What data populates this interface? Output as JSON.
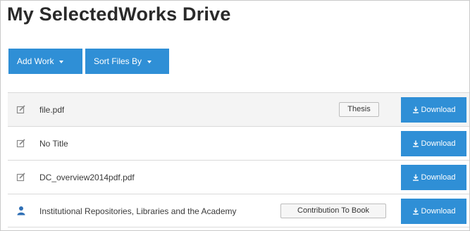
{
  "page": {
    "title": "My SelectedWorks Drive"
  },
  "toolbar": {
    "add_work_label": "Add Work",
    "sort_files_label": "Sort Files By"
  },
  "files": [
    {
      "name": "file.pdf",
      "icon": "edit-icon",
      "type": "Thesis",
      "download_label": "Download"
    },
    {
      "name": "No Title",
      "icon": "edit-icon",
      "type": "",
      "download_label": "Download"
    },
    {
      "name": "DC_overview2014pdf.pdf",
      "icon": "edit-icon",
      "type": "",
      "download_label": "Download"
    },
    {
      "name": "Institutional Repositories, Libraries and the Academy",
      "icon": "user-icon",
      "type": "Contribution To Book",
      "download_label": "Download"
    }
  ],
  "colors": {
    "accent": "#2f8fd6",
    "icon_gray": "#8a8a8a",
    "user_icon": "#2f6fb5"
  }
}
